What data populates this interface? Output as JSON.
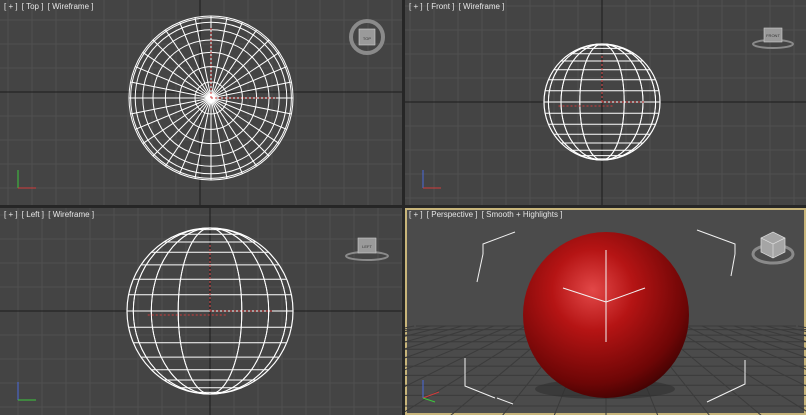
{
  "viewports": [
    {
      "id": "top",
      "menu": "[ + ]",
      "view": "[ Top ]",
      "shading": "[ Wireframe ]",
      "cube_label": "TOP"
    },
    {
      "id": "front",
      "menu": "[ + ]",
      "view": "[ Front ]",
      "shading": "[ Wireframe ]",
      "cube_label": "FRONT"
    },
    {
      "id": "left",
      "menu": "[ + ]",
      "view": "[ Left ]",
      "shading": "[ Wireframe ]",
      "cube_label": "LEFT"
    },
    {
      "id": "perspective",
      "menu": "[ + ]",
      "view": "[ Perspective ]",
      "shading": "[ Smooth + Highlights ]",
      "cube_label": ""
    }
  ],
  "colors": {
    "viewport_bg": "#444444",
    "grid": "#505050",
    "grid_axis": "#1c1c1c",
    "wireframe": "#ffffff",
    "sphere_red": "#b01010",
    "active_border": "#c8b57a",
    "axis_x": "#d23c3c",
    "axis_y": "#3cc83c",
    "axis_z": "#4a6adc"
  },
  "icons": [
    "viewcube-icon",
    "axis-tripod-icon",
    "wireframe-sphere-icon",
    "red-sphere-icon"
  ]
}
